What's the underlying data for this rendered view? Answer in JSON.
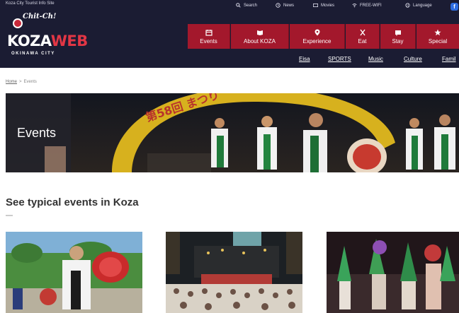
{
  "header": {
    "site_note": "Koza City Tourist Info Site",
    "logo": {
      "badge": "Chit-Ch!",
      "main_a": "KOZA",
      "main_b": "WEB",
      "sub": "OKINAWA CITY"
    },
    "utility": [
      {
        "icon": "search-icon",
        "label": "Search"
      },
      {
        "icon": "news-icon",
        "label": "News"
      },
      {
        "icon": "movie-icon",
        "label": "Movies"
      },
      {
        "icon": "free-wifi-icon",
        "label": "FREE-WIFI"
      },
      {
        "icon": "globe-icon",
        "label": "Language"
      }
    ],
    "nav": [
      {
        "icon": "calendar-icon",
        "label": "Events"
      },
      {
        "icon": "book-icon",
        "label": "About KOZA"
      },
      {
        "icon": "pin-icon",
        "label": "Experience"
      },
      {
        "icon": "utensils-icon",
        "label": "Eat"
      },
      {
        "icon": "bed-icon",
        "label": "Stay"
      },
      {
        "icon": "star-icon",
        "label": "Special"
      }
    ],
    "subnav": [
      "Eisa",
      "SPORTS",
      "Music",
      "Culture",
      "Famil"
    ]
  },
  "breadcrumb": {
    "home": "Home",
    "separator": ">",
    "current": "Events"
  },
  "hero": {
    "title": "Events",
    "banner_text": "第58回 まつり"
  },
  "section": {
    "title": "See typical events in Koza"
  },
  "cards": [
    {
      "image": "eisa-drummer-photo"
    },
    {
      "image": "street-concert-photo"
    },
    {
      "image": "carnival-dancers-photo"
    }
  ],
  "colors": {
    "header_bg": "#1b1c33",
    "nav_red": "#a3182c",
    "logo_red": "#e23645",
    "facebook_blue": "#2f6de0"
  }
}
